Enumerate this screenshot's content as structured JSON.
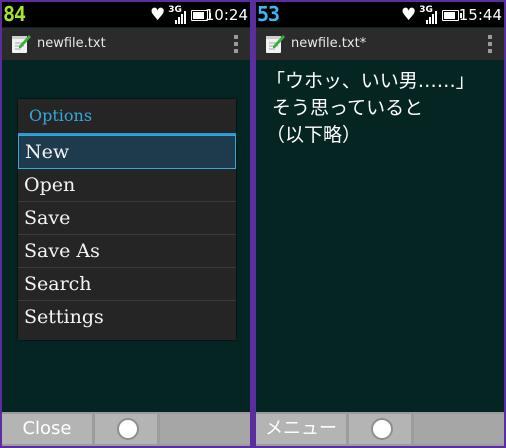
{
  "left": {
    "status": {
      "badge": "84",
      "badge_color": "#a6e22e",
      "network": "3G",
      "time": "10:24",
      "battery_level": 0.7
    },
    "titlebar": {
      "file_title": "newfile.txt"
    },
    "menu": {
      "title": "Options",
      "items": [
        {
          "label": "New",
          "selected": true
        },
        {
          "label": "Open"
        },
        {
          "label": "Save"
        },
        {
          "label": "Save As"
        },
        {
          "label": "Search"
        },
        {
          "label": "Settings"
        }
      ]
    },
    "softkeys": {
      "left": "Close"
    }
  },
  "right": {
    "status": {
      "badge": "53",
      "badge_color": "#3fb6f2",
      "network": "3G",
      "time": "15:44",
      "battery_level": 0.7
    },
    "titlebar": {
      "file_title": "newfile.txt*"
    },
    "editor": {
      "lines": [
        "「ウホッ、いい男……」",
        " そう思っていると",
        "（以下略）"
      ]
    },
    "softkeys": {
      "left": "メニュー"
    }
  },
  "colors": {
    "background": "#052523",
    "frame": "#5b2ea0",
    "accent": "#33a8dc"
  },
  "icons": [
    "heart-icon",
    "signal-icon",
    "battery-icon",
    "notepad-icon",
    "overflow-icon",
    "circle-icon"
  ]
}
